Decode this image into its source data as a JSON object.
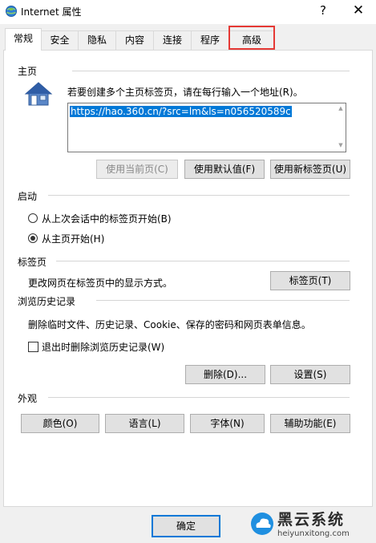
{
  "window": {
    "title": "Internet 属性",
    "help_label": "?",
    "close_label": "✕"
  },
  "tabs": [
    {
      "label": "常规",
      "active": true
    },
    {
      "label": "安全"
    },
    {
      "label": "隐私"
    },
    {
      "label": "内容"
    },
    {
      "label": "连接"
    },
    {
      "label": "程序"
    },
    {
      "label": "高级",
      "highlighted": true
    }
  ],
  "home": {
    "section_label": "主页",
    "instruction": "若要创建多个主页标签页，请在每行输入一个地址(R)。",
    "url": "https://hao.360.cn/?src=lm&ls=n056520589c",
    "use_current_label": "使用当前页(C)",
    "use_default_label": "使用默认值(F)",
    "use_new_tab_label": "使用新标签页(U)"
  },
  "startup": {
    "section_label": "启动",
    "option_last_session": "从上次会话中的标签页开始(B)",
    "option_home": "从主页开始(H)",
    "selected": "option_home"
  },
  "tabs_section": {
    "section_label": "标签页",
    "description": "更改网页在标签页中的显示方式。",
    "button_label": "标签页(T)"
  },
  "history": {
    "section_label": "浏览历史记录",
    "description": "删除临时文件、历史记录、Cookie、保存的密码和网页表单信息。",
    "checkbox_label": "退出时删除浏览历史记录(W)",
    "checkbox_checked": false,
    "delete_label": "删除(D)...",
    "settings_label": "设置(S)"
  },
  "appearance": {
    "section_label": "外观",
    "colors_label": "颜色(O)",
    "languages_label": "语言(L)",
    "fonts_label": "字体(N)",
    "accessibility_label": "辅助功能(E)"
  },
  "footer": {
    "ok_label": "确定"
  },
  "watermark": {
    "brand": "黑云系统",
    "site": "heiyunxitong.com"
  },
  "colors": {
    "accent": "#0078d7",
    "highlight_box": "#e53935"
  }
}
